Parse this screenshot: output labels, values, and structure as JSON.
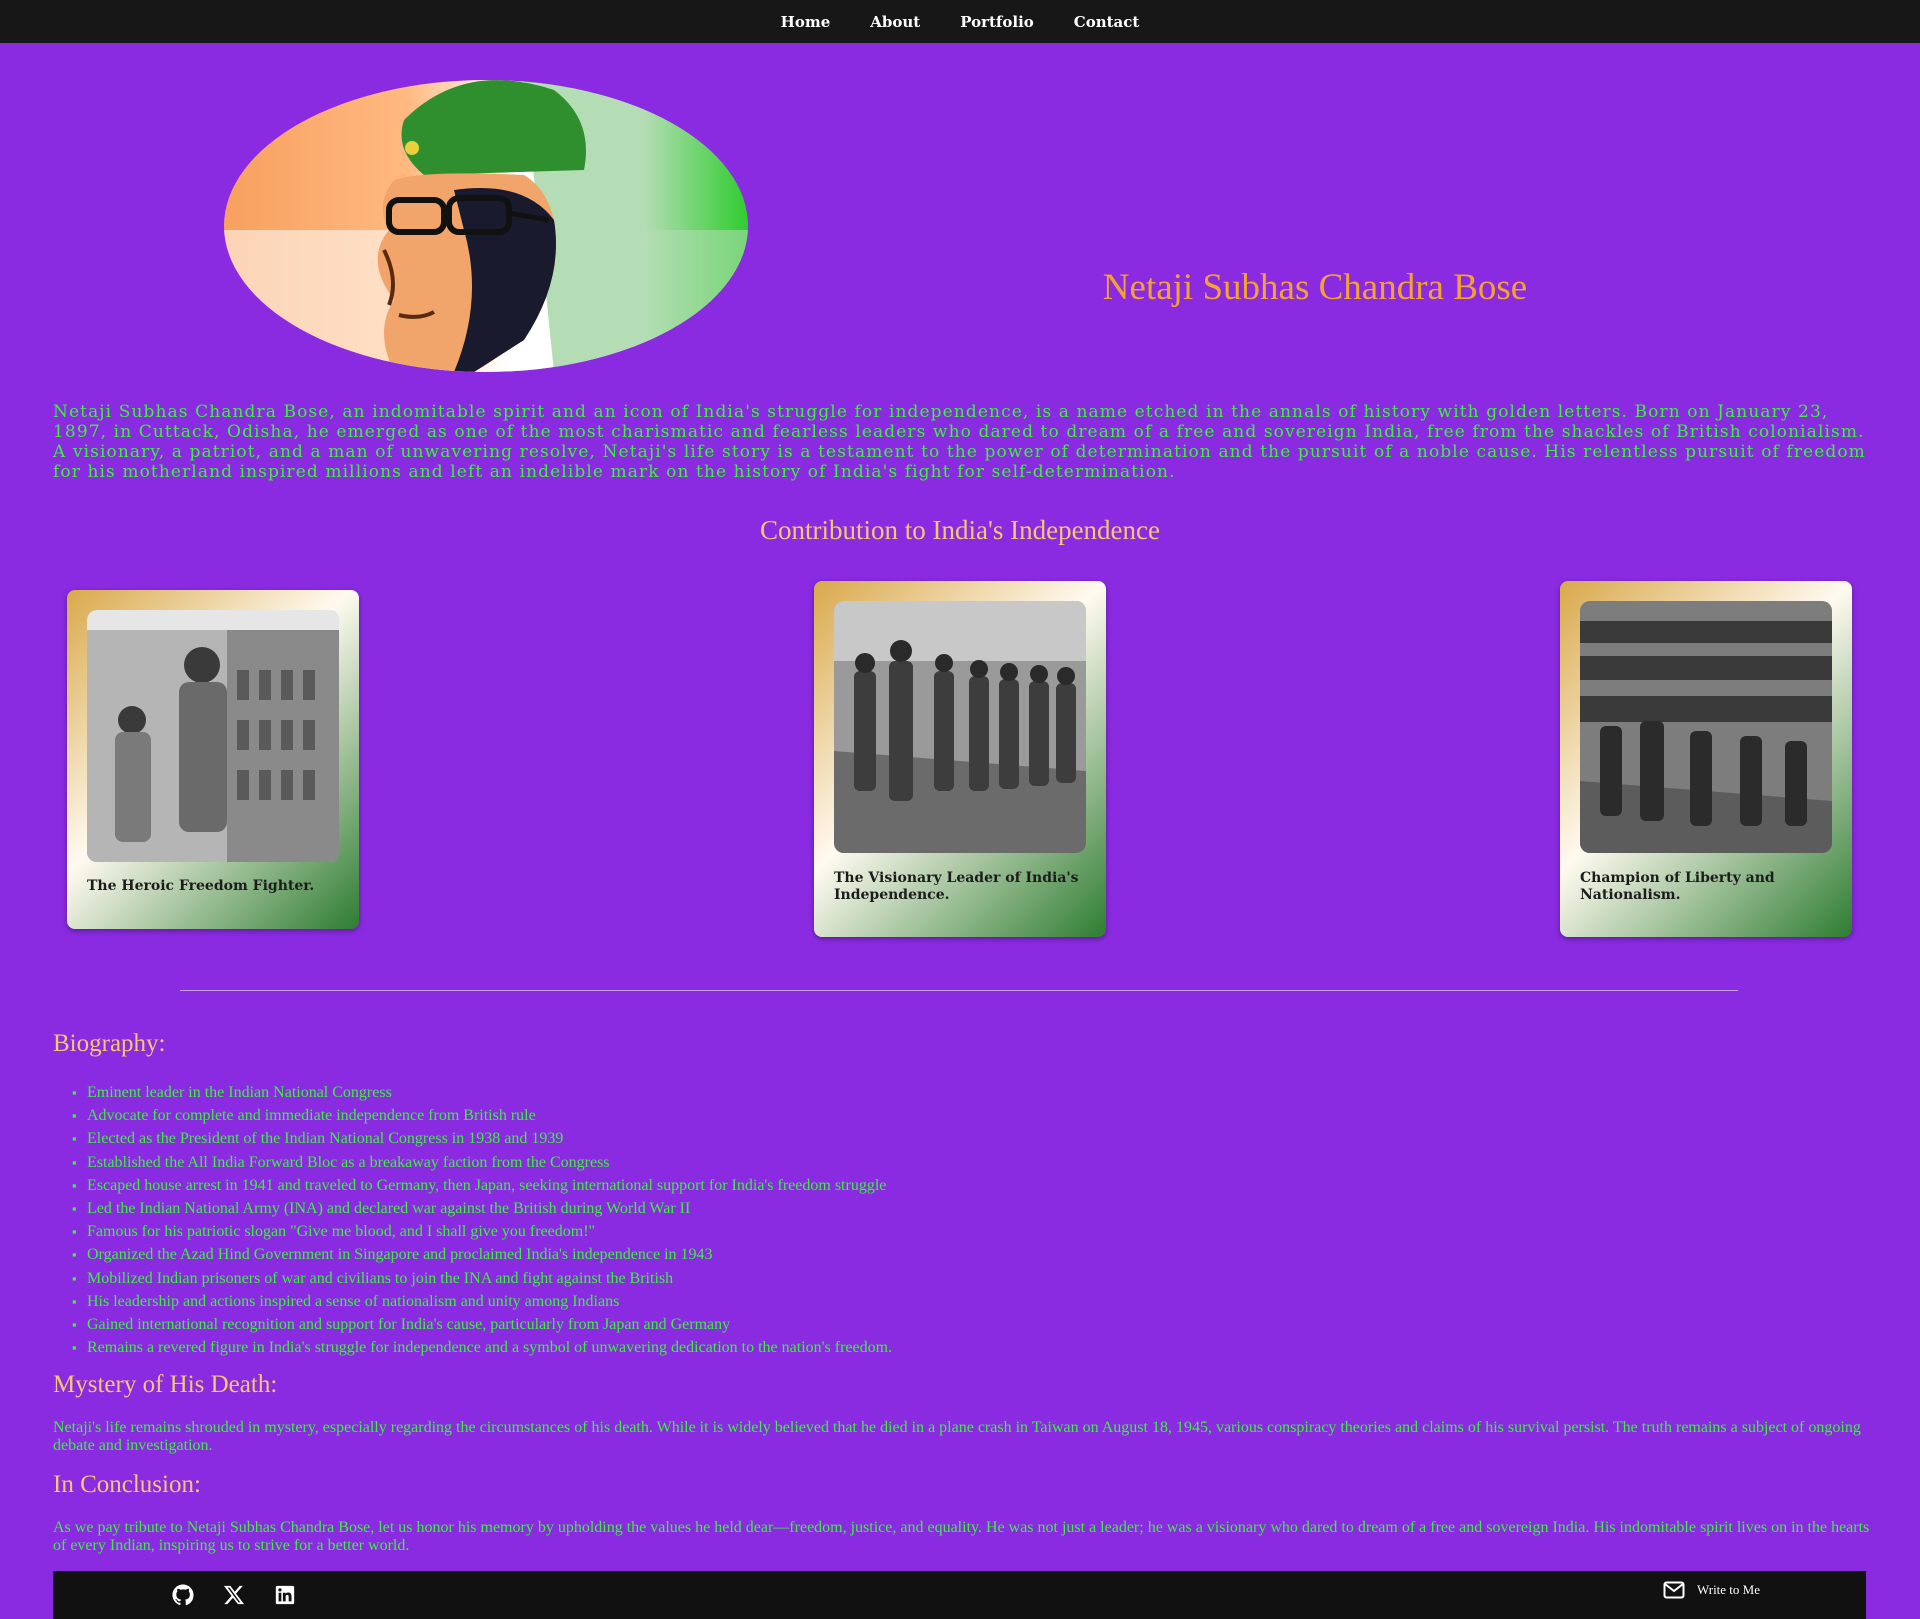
{
  "nav": {
    "items": [
      {
        "label": "Home"
      },
      {
        "label": "About"
      },
      {
        "label": "Portfolio"
      },
      {
        "label": "Contact"
      }
    ]
  },
  "hero": {
    "title": "Netaji Subhas Chandra Bose",
    "portrait_icon": "portrait-image"
  },
  "intro": {
    "text": "Netaji Subhas Chandra Bose, an indomitable spirit and an icon of India's struggle for independence, is a name etched in the annals of history with golden letters. Born on January 23, 1897, in Cuttack, Odisha, he emerged as one of the most charismatic and fearless leaders who dared to dream of a free and sovereign India, free from the shackles of British colonialism. A visionary, a patriot, and a man of unwavering resolve, Netaji's life story is a testament to the power of determination and the pursuit of a noble cause. His relentless pursuit of freedom for his motherland inspired millions and left an indelible mark on the history of India's fight for self-determination."
  },
  "contribution": {
    "heading": "Contribution to India's Independence",
    "cards": [
      {
        "caption": "The Heroic Freedom Fighter."
      },
      {
        "caption": "The Visionary Leader of India's Independence."
      },
      {
        "caption": "Champion of Liberty and Nationalism."
      }
    ]
  },
  "biography": {
    "heading": "Biography:",
    "items": [
      "Eminent leader in the Indian National Congress",
      "Advocate for complete and immediate independence from British rule",
      "Elected as the President of the Indian National Congress in 1938 and 1939",
      "Established the All India Forward Bloc as a breakaway faction from the Congress",
      "Escaped house arrest in 1941 and traveled to Germany, then Japan, seeking international support for India's freedom struggle",
      "Led the Indian National Army (INA) and declared war against the British during World War II",
      "Famous for his patriotic slogan \"Give me blood, and I shall give you freedom!\"",
      "Organized the Azad Hind Government in Singapore and proclaimed India's independence in 1943",
      "Mobilized Indian prisoners of war and civilians to join the INA and fight against the British",
      "His leadership and actions inspired a sense of nationalism and unity among Indians",
      "Gained international recognition and support for India's cause, particularly from Japan and Germany",
      "Remains a revered figure in India's struggle for independence and a symbol of unwavering dedication to the nation's freedom."
    ]
  },
  "mystery": {
    "heading": "Mystery of His Death:",
    "text": "Netaji's life remains shrouded in mystery, especially regarding the circumstances of his death. While it is widely believed that he died in a plane crash in Taiwan on August 18, 1945, various conspiracy theories and claims of his survival persist. The truth remains a subject of ongoing debate and investigation."
  },
  "conclusion": {
    "heading": "In Conclusion:",
    "text": "As we pay tribute to Netaji Subhas Chandra Bose, let us honor his memory by upholding the values he held dear—freedom, justice, and equality. He was not just a leader; he was a visionary who dared to dream of a free and sovereign India. His indomitable spirit lives on in the hearts of every Indian, inspiring us to strive for a better world."
  },
  "footer": {
    "icons": [
      "github-icon",
      "x-icon",
      "linkedin-icon"
    ],
    "write_label": "Write to Me"
  },
  "colors": {
    "background": "#8a2be2",
    "heading_orange": "#f3a230",
    "text_green": "#3cf03c",
    "nav_bg": "#171717"
  }
}
